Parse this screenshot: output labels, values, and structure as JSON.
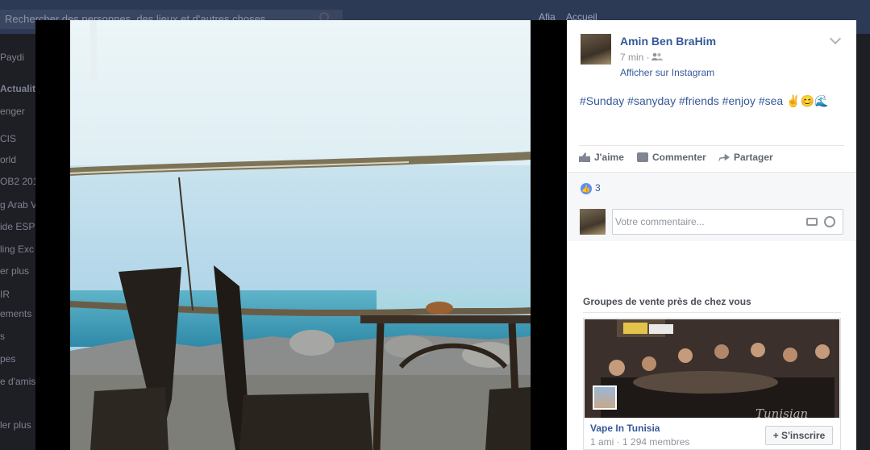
{
  "background": {
    "search_placeholder": "Rechercher des personnes, des lieux et d'autres choses",
    "profile_name": "Afia",
    "profile_link": "Accueil",
    "sidebar_items": [
      "Paydi",
      "Actualité",
      "enger",
      "CIS",
      "orld",
      "OB2 201",
      "g Arab V",
      "ide ESP",
      "ling Exc",
      "er plus",
      "IR",
      "ements",
      "s",
      "pes",
      "e d'amis",
      "ler plus"
    ]
  },
  "post": {
    "author": "Amin Ben BraHim",
    "time": "7 min ·",
    "source_link": "Afficher sur Instagram",
    "caption": "#Sunday #sanyday #friends #enjoy #sea",
    "caption_emojis": "✌😊🌊",
    "actions": {
      "like": "J'aime",
      "comment": "Commenter",
      "share": "Partager"
    },
    "like_count": "3",
    "comment_placeholder": "Votre commentaire..."
  },
  "groups": {
    "title": "Groupes de vente près de chez vous",
    "card": {
      "name": "Vape In Tunisia",
      "members": "1 ami · 1 294 membres",
      "join_label": "+ S'inscrire",
      "watermark": "Tunisian"
    }
  },
  "colors": {
    "link_blue": "#365899",
    "highlight_red": "#d0131b",
    "like_badge": "#5890ff"
  }
}
